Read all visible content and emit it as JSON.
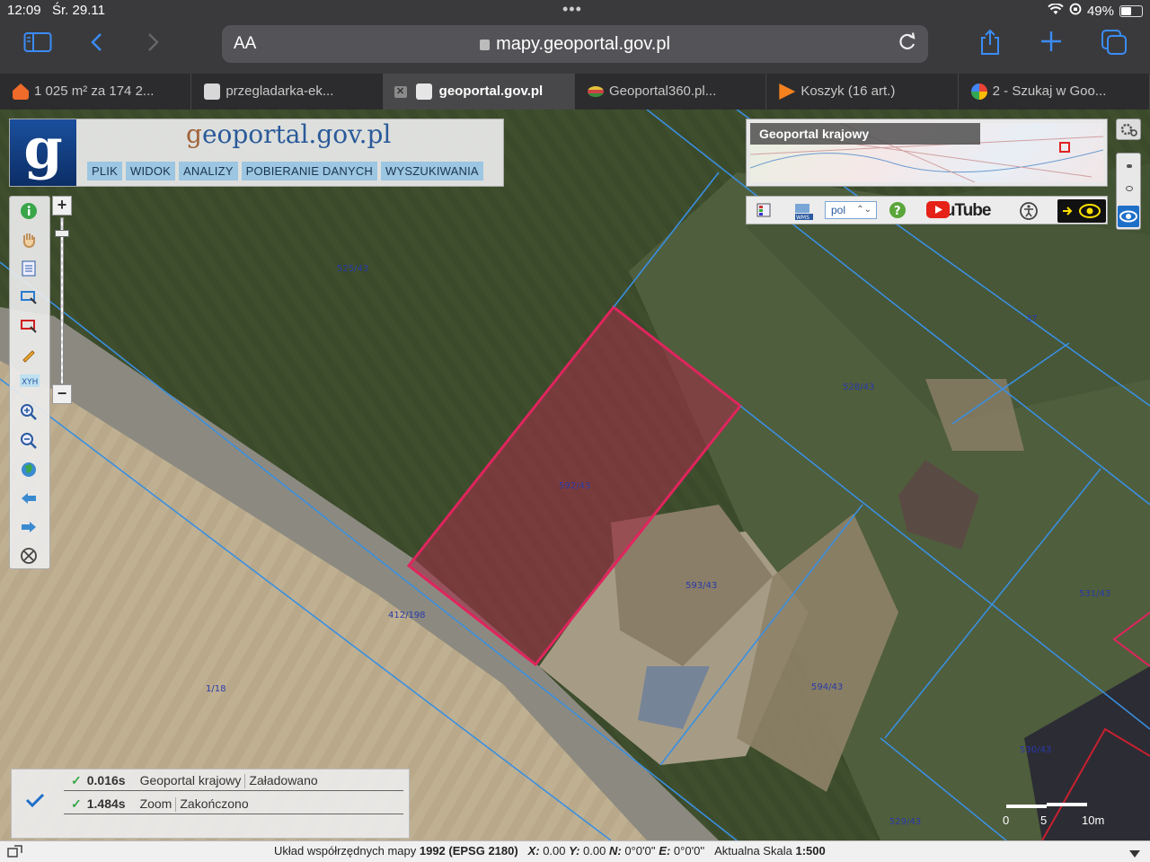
{
  "statusbar": {
    "time": "12:09",
    "date": "Śr. 29.11",
    "battery": "49%"
  },
  "toolbar": {
    "aa": "AA",
    "url": "mapy.geoportal.gov.pl"
  },
  "tabs": [
    {
      "label": "1 025 m² za 174 2...",
      "color": "#f06a2a"
    },
    {
      "label": "przegladarka-ek...",
      "color": "#cfcfcf"
    },
    {
      "label": "geoportal.gov.pl",
      "color": "#e6e6e6",
      "active": true
    },
    {
      "label": "Geoportal360.pl...",
      "color": "#e3c23a"
    },
    {
      "label": "Koszyk (16 art.)",
      "color": "#f5821f"
    },
    {
      "label": "2 - Szukaj w Goo...",
      "color": "#4285f4"
    }
  ],
  "geoportal": {
    "logo_letter": "g",
    "title_first": "g",
    "title_rest": "eoportal.gov.pl",
    "menu": [
      "PLIK",
      "WIDOK",
      "ANALIZY",
      "POBIERANIE DANYCH",
      "WYSZUKIWANIA"
    ],
    "zoom_in": "+",
    "zoom_out": "−",
    "overview_title": "Geoportal krajowy",
    "lang": "pol",
    "youtube": "YouTube"
  },
  "parcels": [
    "525/43",
    "37",
    "528/43",
    "592/43",
    "593/43",
    "412/198",
    "531/43",
    "1/18",
    "594/43",
    "530/43",
    "529/43"
  ],
  "status": {
    "rows": [
      {
        "time": "0.016s",
        "source": "Geoportal krajowy",
        "state": "Załadowano"
      },
      {
        "time": "1.484s",
        "source": "Zoom",
        "state": "Zakończono"
      }
    ]
  },
  "scale": {
    "ticks": [
      "0",
      "5",
      "10m"
    ]
  },
  "footer": {
    "crs_label": "Układ współrzędnych mapy",
    "crs_value": "1992 (EPSG 2180)",
    "x_label": "X:",
    "x_value": "0.00",
    "y_label": "Y:",
    "y_value": "0.00",
    "n_label": "N:",
    "n_value": "0°0'0''",
    "e_label": "E:",
    "e_value": "0°0'0''",
    "scale_label": "Aktualna Skala",
    "scale_value": "1:500"
  },
  "colors": {
    "parcel_line": "#3a8fe0",
    "selected_parcel": "#e0245e",
    "safari_blue": "#3b8cf5"
  }
}
